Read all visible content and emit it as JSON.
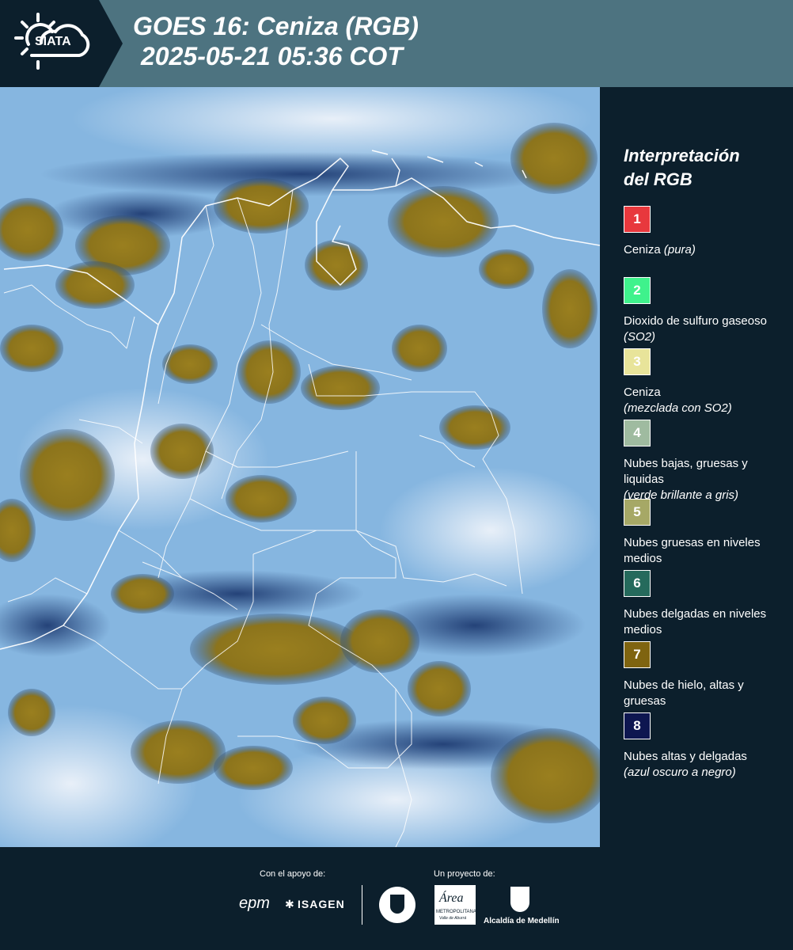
{
  "header": {
    "logo_text": "SIATA",
    "title_line1": "GOES 16: Ceniza (RGB)",
    "title_line2": "2025-05-21 05:36 COT"
  },
  "legend": {
    "title_line1": "Interpretación",
    "title_line2": "del RGB",
    "items": [
      {
        "num": "1",
        "color": "#e8383d",
        "text": "Ceniza ",
        "note": "(pura)"
      },
      {
        "num": "2",
        "color": "#3ff28c",
        "text": "Dioxido de sulfuro gaseoso ",
        "note": "(SO2)"
      },
      {
        "num": "3",
        "color": "#e8e49a",
        "text": "Ceniza",
        "note": "(mezclada con SO2)"
      },
      {
        "num": "4",
        "color": "#9fbba0",
        "text": "Nubes bajas, gruesas y liquidas",
        "note": "(verde brillante a gris)"
      },
      {
        "num": "5",
        "color": "#a6a866",
        "text": "Nubes gruesas en niveles medios",
        "note": ""
      },
      {
        "num": "6",
        "color": "#256a5c",
        "text": "Nubes delgadas en niveles medios",
        "note": ""
      },
      {
        "num": "7",
        "color": "#7f6410",
        "text": "Nubes de hielo, altas y gruesas",
        "note": ""
      },
      {
        "num": "8",
        "color": "#0d1650",
        "text": "Nubes altas y delgadas",
        "note": "(azul oscuro a negro)"
      }
    ]
  },
  "footer": {
    "support_label": "Con el apoyo de:",
    "project_label": "Un proyecto de:",
    "sponsor1": "epm",
    "sponsor2": "ISAGEN",
    "partner1": "METROPOLITANA",
    "partner1b": "Valle de Aburrá",
    "partner2": "Alcaldía de Medellín"
  }
}
